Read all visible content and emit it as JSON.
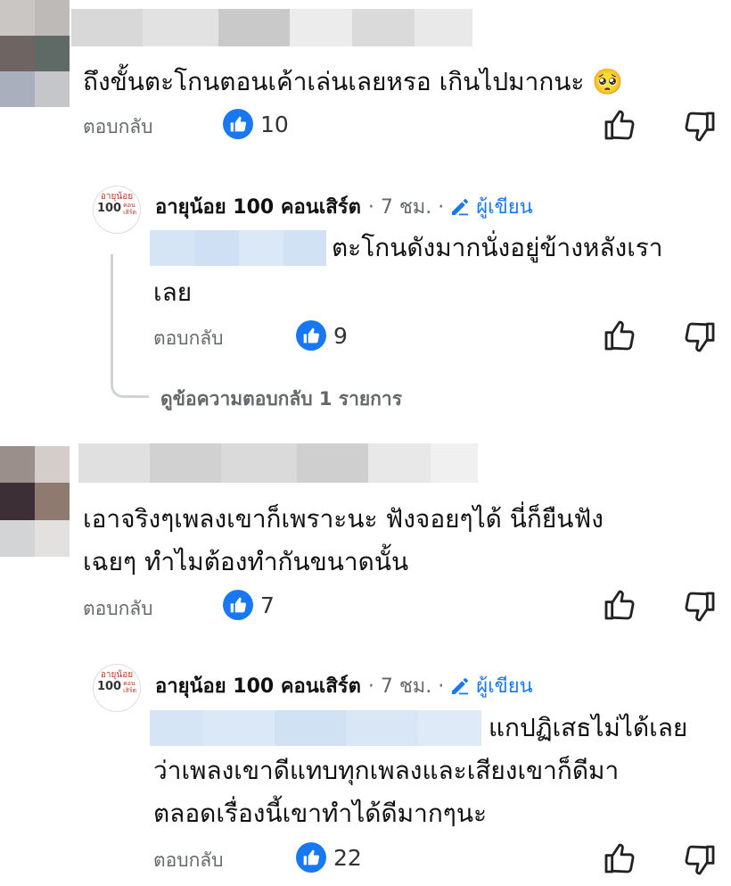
{
  "comments": [
    {
      "text_lines": [
        "ถึงขั้นตะโกนตอนเค้าเล่นเลยหรอ เกินไปมากนะ 🥺"
      ],
      "reply_label": "ตอบกลับ",
      "like_count": "10"
    },
    {
      "text_lines": [
        "เอาจริงๆเพลงเขาก็เพราะนะ ฟังจอยๆได้ นี่ก็ยืนฟัง",
        "เฉยๆ ทำไมต้องทำกันขนาดนั้น"
      ],
      "reply_label": "ตอบกลับ",
      "like_count": "7"
    }
  ],
  "replies": [
    {
      "page_avatar_line1": "อายุน้อย",
      "page_avatar_line2": "100",
      "page_avatar_line3": "คอน",
      "page_avatar_line4": "เสิร์ต",
      "author_name": "อายุน้อย 100 คอนเสิร์ต",
      "time": "· 7 ชม. ·",
      "author_badge": "ผู้เขียน",
      "text_lines": [
        "ตะโกนดังมากนั่งอยู่ข้างหลังเรา",
        "เลย"
      ],
      "reply_label": "ตอบกลับ",
      "like_count": "9",
      "view_replies": "ดูข้อความตอบกลับ 1 รายการ"
    },
    {
      "page_avatar_line1": "อายุน้อย",
      "page_avatar_line2": "100",
      "page_avatar_line3": "คอน",
      "page_avatar_line4": "เสิร์ต",
      "author_name": "อายุน้อย 100 คอนเสิร์ต",
      "time": "· 7 ชม. ·",
      "author_badge": "ผู้เขียน",
      "text_lines": [
        "แกปฏิเสธไม่ได้เลย",
        "ว่าเพลงเขาดีแทบทุกเพลงและเสียงเขาก็ดีมา",
        "ตลอดเรื่องนี้เขาทำได้ดีมากๆนะ"
      ],
      "reply_label": "ตอบกลับ",
      "like_count": "22"
    }
  ],
  "colors": {
    "facebook_blue": "#1877f2",
    "meta_gray": "#65676b"
  },
  "icons": {
    "like_badge": "thumbs-up-icon",
    "like_button": "thumbs-up-outline-icon",
    "dislike_button": "thumbs-down-outline-icon",
    "author_badge": "pencil-icon"
  }
}
